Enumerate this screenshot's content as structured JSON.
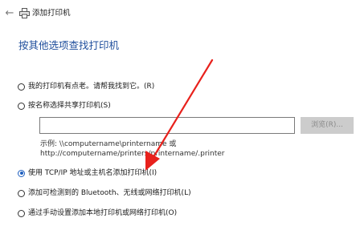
{
  "window": {
    "title": "添加打印机",
    "back_icon": "back-arrow-icon",
    "printer_icon": "printer-icon"
  },
  "heading": "按其他选项查找打印机",
  "options": [
    {
      "label": "我的打印机有点老。请帮我找到它。(R)",
      "checked": false
    },
    {
      "label": "按名称选择共享打印机(S)",
      "checked": false
    },
    {
      "label": "使用 TCP/IP 地址或主机名添加打印机(I)",
      "checked": true
    },
    {
      "label": "添加可检测到的 Bluetooth、无线或网络打印机(L)",
      "checked": false
    },
    {
      "label": "通过手动设置添加本地打印机或网络打印机(O)",
      "checked": false
    }
  ],
  "shared_printer": {
    "input_value": "",
    "browse_label": "浏览(R)...",
    "example_line1": "示例: \\\\computername\\printername 或",
    "example_line2": "http://computername/printers/printername/.printer"
  },
  "colors": {
    "heading": "#1f4e9c",
    "arrow": "#e8211c",
    "radio_selected": "#1e5fbf"
  }
}
